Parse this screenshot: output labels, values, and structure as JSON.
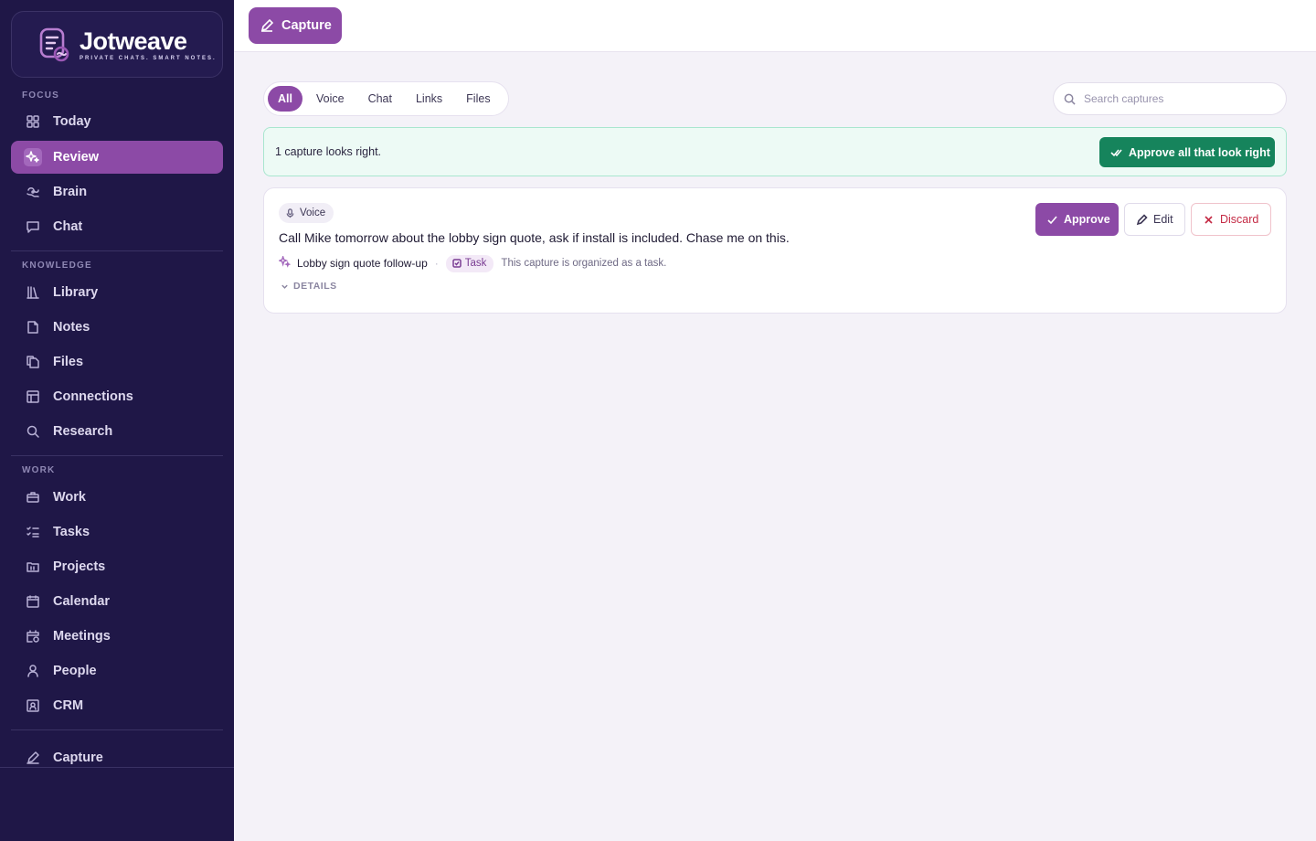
{
  "brand": {
    "name": "Jotweave",
    "tagline": "PRIVATE CHATS. SMART NOTES."
  },
  "sidebar": {
    "sections": {
      "focus": "FOCUS",
      "knowledge": "KNOWLEDGE",
      "work": "WORK"
    },
    "items": [
      {
        "label": "Today",
        "icon": "grid-icon"
      },
      {
        "label": "Review",
        "icon": "sparkle-icon",
        "active": true
      },
      {
        "label": "Brain",
        "icon": "brain-icon"
      },
      {
        "label": "Chat",
        "icon": "chat-icon"
      },
      {
        "label": "Library",
        "icon": "library-icon"
      },
      {
        "label": "Notes",
        "icon": "note-icon"
      },
      {
        "label": "Files",
        "icon": "files-icon"
      },
      {
        "label": "Connections",
        "icon": "layout-icon"
      },
      {
        "label": "Research",
        "icon": "search-icon"
      },
      {
        "label": "Work",
        "icon": "briefcase-icon"
      },
      {
        "label": "Tasks",
        "icon": "checklist-icon"
      },
      {
        "label": "Projects",
        "icon": "folder-icon"
      },
      {
        "label": "Calendar",
        "icon": "calendar-icon"
      },
      {
        "label": "Meetings",
        "icon": "calendar-clock-icon"
      },
      {
        "label": "People",
        "icon": "person-icon"
      },
      {
        "label": "CRM",
        "icon": "contact-card-icon"
      },
      {
        "label": "Capture",
        "icon": "pencil-icon"
      }
    ]
  },
  "topbar": {
    "capture_label": "Capture"
  },
  "filters": {
    "tabs": [
      "All",
      "Voice",
      "Chat",
      "Links",
      "Files"
    ],
    "active": "All"
  },
  "search": {
    "placeholder": "Search captures"
  },
  "banner": {
    "text": "1 capture looks right.",
    "approve_all_label": "Approve all that look right"
  },
  "captures": [
    {
      "source": "Voice",
      "text": "Call Mike tomorrow about the lobby sign quote, ask if install is included. Chase me on this.",
      "title": "Lobby sign quote follow-up",
      "type": "Task",
      "note": "This capture is organized as a task.",
      "details_label": "DETAILS",
      "actions": {
        "approve": "Approve",
        "edit": "Edit",
        "discard": "Discard"
      }
    }
  ],
  "colors": {
    "sidebar_bg": "#1f1747",
    "accent": "#8c4aa6",
    "success": "#16845c",
    "danger": "#c42a44"
  }
}
